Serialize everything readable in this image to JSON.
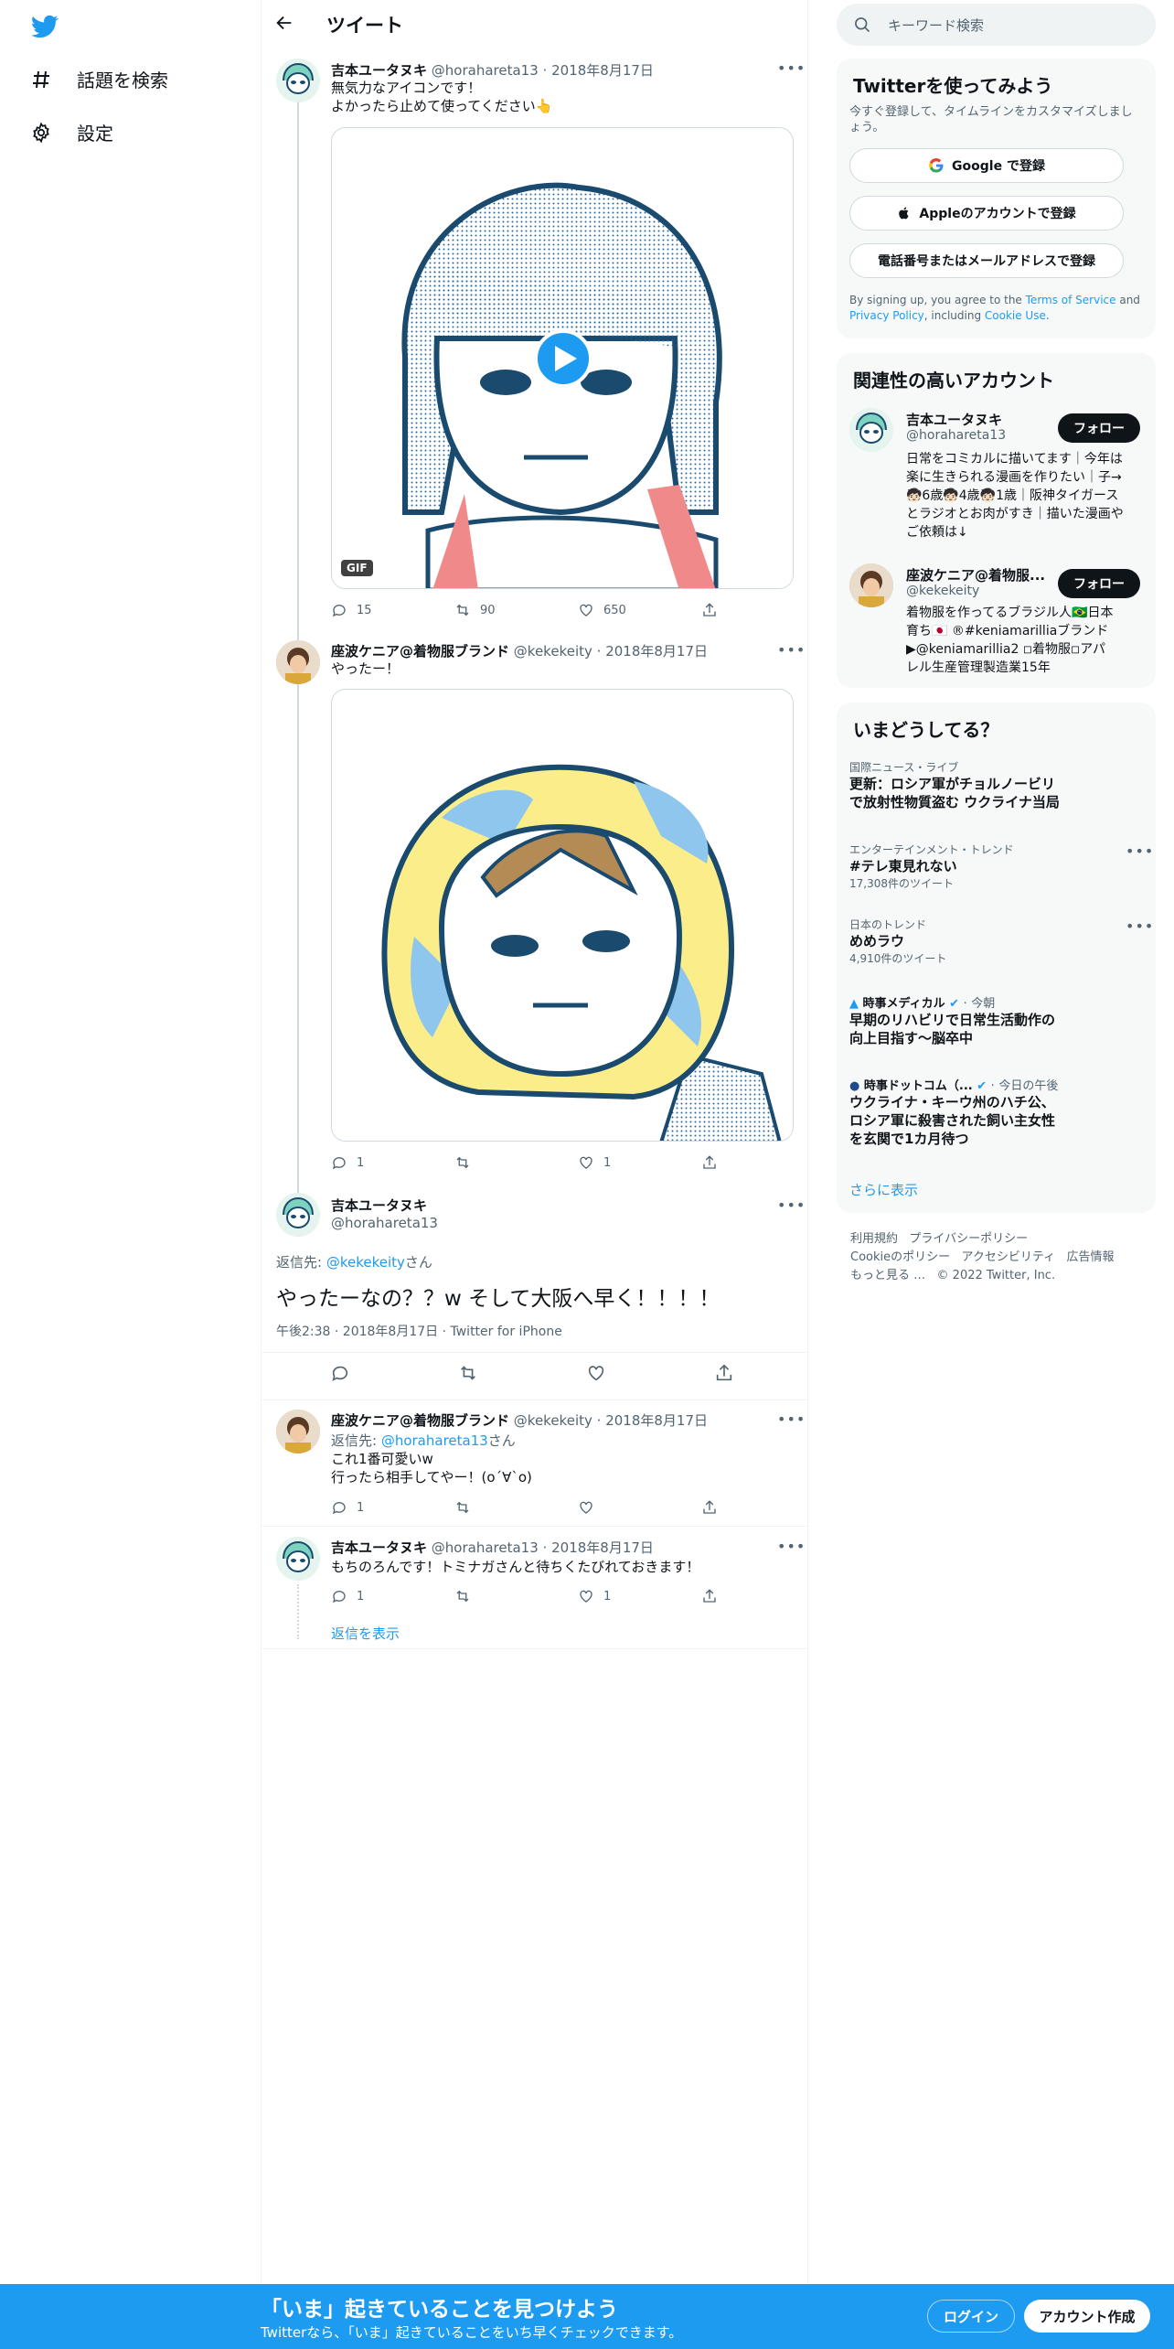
{
  "nav": {
    "explore_label": "話題を検索",
    "settings_label": "設定"
  },
  "header": {
    "title": "ツイート"
  },
  "tweets": [
    {
      "author": "吉本ユータヌキ",
      "handle": "@horahareta13",
      "date": "2018年8月17日",
      "text_lines": [
        "無気力なアイコンです！",
        "よかったら止めて使ってください👆"
      ],
      "media_badge": "GIF",
      "replies": "15",
      "retweets": "90",
      "likes": "650"
    },
    {
      "author": "座波ケニア@着物服ブランド",
      "handle": "@kekekeity",
      "date": "2018年8月17日",
      "text_lines": [
        "やったー！"
      ],
      "replies": "1",
      "retweets": "",
      "likes": "1"
    }
  ],
  "focus": {
    "author": "吉本ユータヌキ",
    "handle": "@horahareta13",
    "reply_to_prefix": "返信先: ",
    "reply_to_handle": "@kekekeity",
    "reply_to_suffix": "さん",
    "text": "やったーなの？？w そして大阪へ早く！！！！",
    "meta": "午後2:38 · 2018年8月17日 · Twitter for iPhone"
  },
  "replies": [
    {
      "author": "座波ケニア@着物服ブランド",
      "handle": "@kekekeity",
      "date": "2018年8月17日",
      "reply_prefix": "返信先: ",
      "reply_handle": "@horahareta13",
      "reply_suffix": "さん",
      "text_lines": [
        "これ1番可愛いw",
        "行ったら相手してやー！(o´∀`o)"
      ],
      "replies": "1",
      "likes": ""
    },
    {
      "author": "吉本ユータヌキ",
      "handle": "@horahareta13",
      "date": "2018年8月17日",
      "text_lines": [
        "もちのろんです！トミナガさんと待ちくたびれておきます！"
      ],
      "replies": "1",
      "likes": "1"
    }
  ],
  "show_replies": "返信を表示",
  "search": {
    "placeholder": "キーワード検索"
  },
  "signup_card": {
    "title": "Twitterを使ってみよう",
    "subtitle": "今すぐ登録して、タイムラインをカスタマイズしましょう。",
    "google": "Google で登録",
    "apple": "Appleのアカウントで登録",
    "phone": "電話番号またはメールアドレスで登録",
    "legal_prefix": "By signing up, you agree to the ",
    "terms": "Terms of Service",
    "and": " and ",
    "privacy": "Privacy Policy",
    "including": ", including ",
    "cookie": "Cookie Use",
    "period": "."
  },
  "related": {
    "title": "関連性の高いアカウント",
    "follow_label": "フォロー",
    "accounts": [
      {
        "name": "吉本ユータヌキ",
        "handle": "@horahareta13",
        "bio_lines": [
          "日常をコミカルに描いてます｜今年は",
          "楽に生きられる漫画を作りたい｜子→",
          "🧒🏻6歳🧒🏻4歳🧒🏻1歳｜阪神タイガース",
          "とラジオとお肉がすき｜描いた漫画や",
          "ご依頼は↓"
        ]
      },
      {
        "name": "座波ケニア@着物服...",
        "handle": "@kekekeity",
        "bio_lines": [
          "着物服を作ってるブラジル人🇧🇷日本",
          "育ち🇯🇵 ®#keniamarilliaブランド",
          "▶@keniamarillia2 ◽着物服◽アパ",
          "レル生産管理製造業15年"
        ]
      }
    ]
  },
  "trends": {
    "title": "いまどうしてる？",
    "items": [
      {
        "category": "国際ニュース・ライブ",
        "title_lines": [
          "更新：ロシア軍がチョルノービリ",
          "で放射性物質盗む ウクライナ当局"
        ],
        "count": ""
      },
      {
        "category": "エンターテインメント・トレンド",
        "title_lines": [
          "#テレ東見れない"
        ],
        "count": "17,308件のツイート"
      },
      {
        "category": "日本のトレンド",
        "title_lines": [
          "めめラウ"
        ],
        "count": "4,910件のツイート"
      },
      {
        "category": "時事メディカル",
        "time": "今朝",
        "title_lines": [
          "早期のリハビリで日常生活動作の",
          "向上目指す～脳卒中"
        ],
        "count": ""
      },
      {
        "category": "時事ドットコム（...",
        "time": "今日の午後",
        "title_lines": [
          "ウクライナ・キーウ州のハチ公、",
          "ロシア軍に殺害された飼い主女性",
          "を玄関で1カ月待つ"
        ],
        "count": ""
      }
    ],
    "show_more": "さらに表示"
  },
  "footer": {
    "terms": "利用規約",
    "privacy": "プライバシーポリシー",
    "cookie": "Cookieのポリシー",
    "accessibility": "アクセシビリティ",
    "ads": "広告情報",
    "more": "もっと見る …",
    "copyright": "© 2022 Twitter, Inc."
  },
  "bottom": {
    "title": "「いま」起きていることを見つけよう",
    "subtitle": "Twitterなら、「いま」起きていることをいち早くチェックできます。",
    "login": "ログイン",
    "signup": "アカウント作成"
  },
  "colors": {
    "accent": "#1d9bf0",
    "text": "#0f1419",
    "muted": "#536471"
  }
}
